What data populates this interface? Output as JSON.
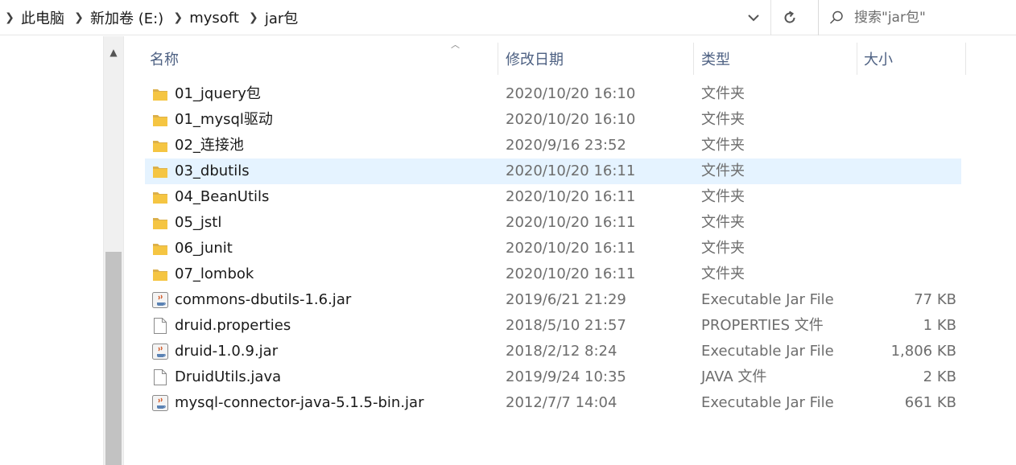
{
  "breadcrumb": {
    "items": [
      "此电脑",
      "新加卷 (E:)",
      "mysoft",
      "jar包"
    ]
  },
  "search": {
    "placeholder": "搜索\"jar包\""
  },
  "columns": {
    "name": "名称",
    "date": "修改日期",
    "type": "类型",
    "size": "大小"
  },
  "files": [
    {
      "name": "01_jquery包",
      "date": "2020/10/20 16:10",
      "type": "文件夹",
      "size": "",
      "icon": "folder-icon"
    },
    {
      "name": "01_mysql驱动",
      "date": "2020/10/20 16:10",
      "type": "文件夹",
      "size": "",
      "icon": "folder-icon"
    },
    {
      "name": "02_连接池",
      "date": "2020/9/16 23:52",
      "type": "文件夹",
      "size": "",
      "icon": "folder-icon"
    },
    {
      "name": "03_dbutils",
      "date": "2020/10/20 16:11",
      "type": "文件夹",
      "size": "",
      "icon": "folder-icon",
      "selected": true
    },
    {
      "name": "04_BeanUtils",
      "date": "2020/10/20 16:11",
      "type": "文件夹",
      "size": "",
      "icon": "folder-icon"
    },
    {
      "name": "05_jstl",
      "date": "2020/10/20 16:11",
      "type": "文件夹",
      "size": "",
      "icon": "folder-icon"
    },
    {
      "name": "06_junit",
      "date": "2020/10/20 16:11",
      "type": "文件夹",
      "size": "",
      "icon": "folder-icon"
    },
    {
      "name": "07_lombok",
      "date": "2020/10/20 16:11",
      "type": "文件夹",
      "size": "",
      "icon": "folder-icon"
    },
    {
      "name": "commons-dbutils-1.6.jar",
      "date": "2019/6/21 21:29",
      "type": "Executable Jar File",
      "size": "77 KB",
      "icon": "jar-file-icon"
    },
    {
      "name": "druid.properties",
      "date": "2018/5/10 21:57",
      "type": "PROPERTIES 文件",
      "size": "1 KB",
      "icon": "blank-file-icon"
    },
    {
      "name": "druid-1.0.9.jar",
      "date": "2018/2/12 8:24",
      "type": "Executable Jar File",
      "size": "1,806 KB",
      "icon": "jar-file-icon"
    },
    {
      "name": "DruidUtils.java",
      "date": "2019/9/24 10:35",
      "type": "JAVA 文件",
      "size": "2 KB",
      "icon": "blank-file-icon"
    },
    {
      "name": "mysql-connector-java-5.1.5-bin.jar",
      "date": "2012/7/7 14:04",
      "type": "Executable Jar File",
      "size": "661 KB",
      "icon": "jar-file-icon"
    }
  ],
  "colors": {
    "selection": "#e5f3ff",
    "folder": "#f5c542",
    "header_text": "#4d6082"
  }
}
